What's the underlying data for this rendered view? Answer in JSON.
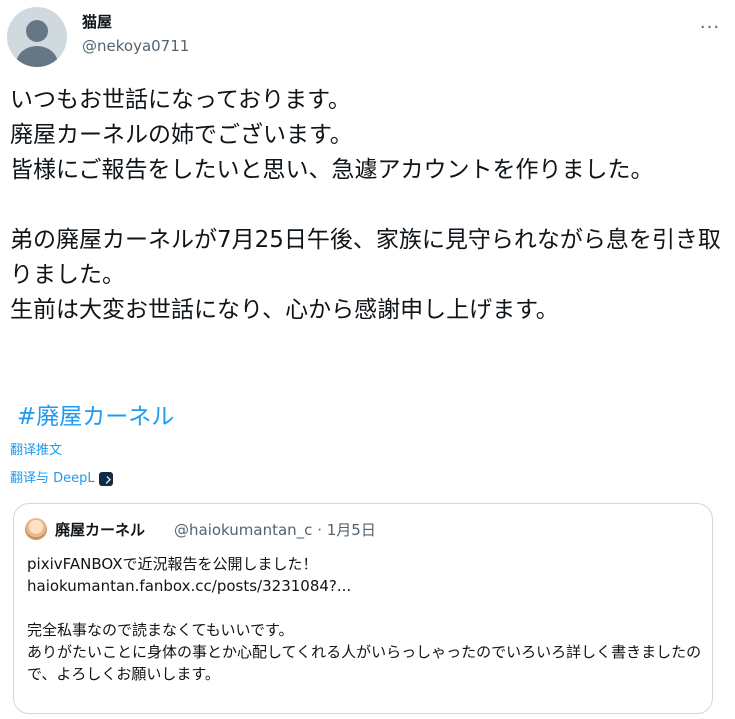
{
  "user": {
    "name": "猫屋",
    "handle": "@nekoya0711"
  },
  "more_label": "···",
  "tweet": {
    "text": "いつもお世話になっております。\n廃屋カーネルの姉でございます。\n皆様にご報告をしたいと思い、急遽アカウントを作りました。\n\n弟の廃屋カーネルが7月25日午後、家族に見守られながら息を引き取りました。\n生前は大変お世話になり、心から感謝申し上げます。",
    "hashtag": "#廃屋カーネル",
    "translate_link": "翻译推文",
    "deepl_link": "翻译与 DeepL"
  },
  "quote": {
    "name": "廃屋カーネル",
    "handle": "@haiokumantan_c",
    "separator": "·",
    "date": "1月5日",
    "text": "pixivFANBOXで近況報告を公開しました！\nhaiokumantan.fanbox.cc/posts/3231084?...\n\n完全私事なので読まなくてもいいです。\nありがたいことに身体の事とか心配してくれる人がいらっしゃったのでいろいろ詳しく書きましたので、よろしくお願いします。"
  },
  "colors": {
    "link": "#1d9bf0",
    "secondary_text": "#536471",
    "border": "#cfd9de"
  },
  "icons": {
    "avatar": "default-avatar-icon",
    "more": "more-dots-icon",
    "deepl": "deepl-icon"
  }
}
